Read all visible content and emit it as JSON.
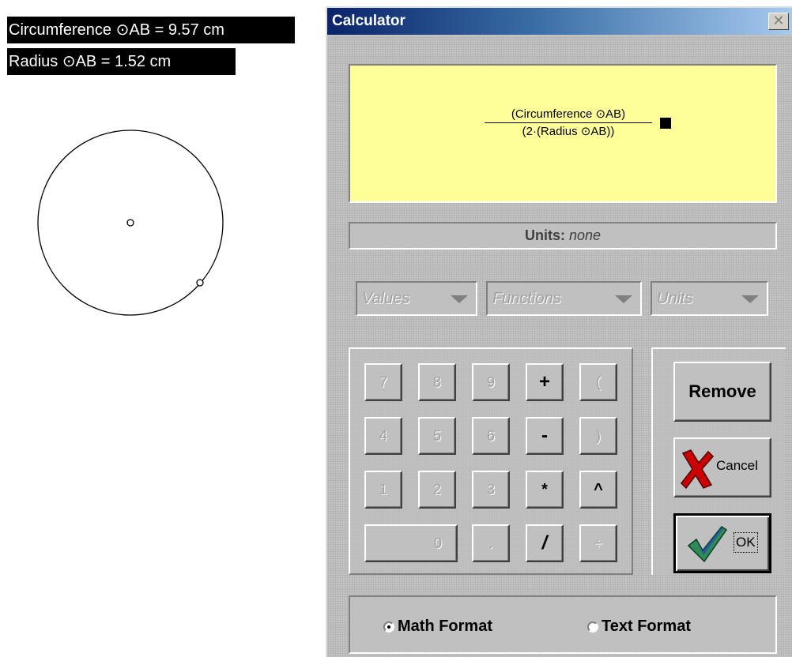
{
  "measurements": {
    "circumference": "Circumference ⊙AB = 9.57 cm",
    "radius": "Radius ⊙AB = 1.52 cm"
  },
  "sketch": {
    "icons": [
      "circle-shape",
      "center-point",
      "radius-point"
    ]
  },
  "dialog": {
    "title": "Calculator",
    "close_label": "✕",
    "expression": {
      "numerator": "(Circumference ⊙AB)",
      "denominator": "(2·(Radius ⊙AB))"
    },
    "units": {
      "label": "Units:",
      "value": "none"
    },
    "menus": {
      "values": "Values",
      "functions": "Functions",
      "units": "Units"
    },
    "keys": [
      "7",
      "8",
      "9",
      "+",
      "(",
      "4",
      "5",
      "6",
      "-",
      ")",
      "1",
      "2",
      "3",
      "*",
      "^",
      "0",
      ".",
      "/",
      "÷"
    ],
    "buttons": {
      "remove": "Remove",
      "cancel": "Cancel",
      "ok": "OK"
    },
    "format": {
      "math": "Math Format",
      "text": "Text Format",
      "selected": "Math Format"
    },
    "colors": {
      "display_bg": "#ffff99",
      "titlebar_start": "#0a246a",
      "titlebar_end": "#a6caf0",
      "cancel_x": "#cc0000",
      "ok_check": "#2e8b57"
    }
  }
}
